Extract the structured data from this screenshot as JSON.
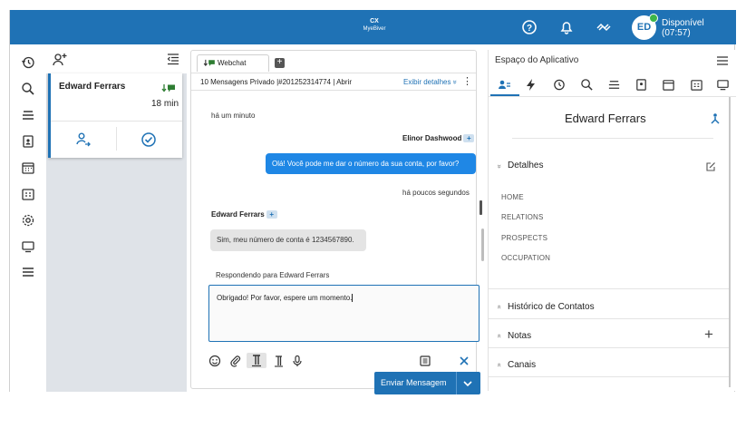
{
  "topbar": {
    "logo_line1": "CX",
    "logo_line2": "MyeBiver",
    "status_label": "Disponível",
    "status_time": "(07:57)",
    "avatar_initials": "ED",
    "colors": {
      "bar": "#1f72b5",
      "presence": "#3cb54a"
    }
  },
  "queue": {
    "card": {
      "name": "Edward Ferrars",
      "time": "18 min"
    }
  },
  "chat": {
    "tab_label": "Webchat",
    "add_tab": "+",
    "info": {
      "messages": "10 Mensagens",
      "privacy": "Privado",
      "ticket": "|#201252314774",
      "state": "| Abrir",
      "details_link": "Exibir detalhes",
      "details_chevron": "»",
      "more": "⋮"
    },
    "time1": "há um minuto",
    "agent_name": "Elinor Dashwood",
    "agent_message": "Olá! Você pode me dar o número da sua conta, por favor?",
    "time2": "há poucos segundos",
    "customer_name": "Edward Ferrars",
    "customer_message": "Sim, meu número de conta é 1234567890.",
    "plus_tag": "+",
    "reply_label": "Respondendo para Edward Ferrars",
    "reply_text": "Obrigado! Por favor, espere um momento.",
    "send_label": "Enviar Mensagem",
    "colors": {
      "outgoing": "#1f87e5",
      "incoming": "#e4e4e4"
    }
  },
  "apps": {
    "title": "Espaço do Aplicativo",
    "contact_name": "Edward Ferrars",
    "sections": {
      "details": "Detalhes",
      "history": "Histórico de Contatos",
      "notes": "Notas",
      "channels": "Canais"
    },
    "details_items": [
      "HOME",
      "RELATIONS",
      "PROSPECTS",
      "OCCUPATION"
    ],
    "chevron_open": "»",
    "chevron_closed": "«",
    "notes_add": "+"
  }
}
